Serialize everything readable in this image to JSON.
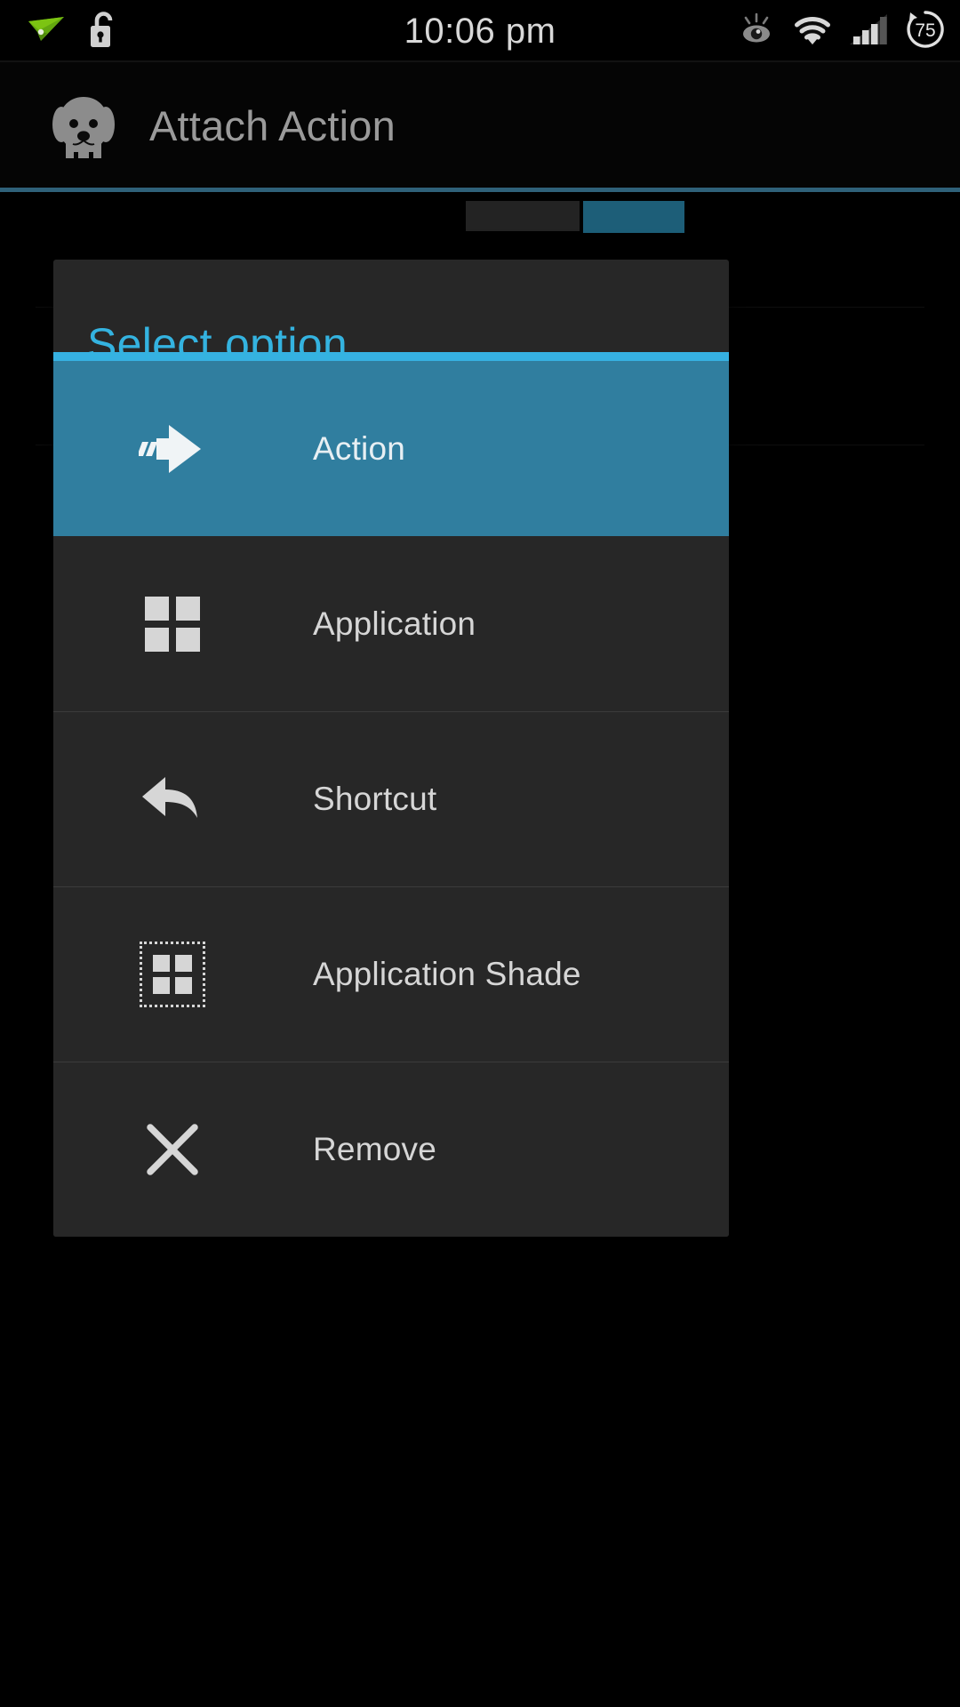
{
  "status_bar": {
    "time": "10:06 pm",
    "left_icons": [
      {
        "name": "airdroid-paperplane-icon",
        "label": "AirDroid"
      },
      {
        "name": "unlocked-padlock-icon",
        "label": "Unlocked"
      }
    ],
    "right_icons": [
      {
        "name": "eye-icon",
        "label": "Eye / screen filter"
      },
      {
        "name": "wifi-icon",
        "label": "Wi-Fi full signal"
      },
      {
        "name": "cellular-signal-icon",
        "label": "Cellular signal 3 of 4 bars"
      }
    ],
    "battery": {
      "name": "battery-circle-icon",
      "percent": "75"
    }
  },
  "action_bar": {
    "icon_name": "dog-app-icon",
    "title": "Attach Action"
  },
  "dialog": {
    "title": "Select option",
    "options": [
      {
        "label": "Action",
        "icon": "fast-forward-arrow-icon",
        "selected": true
      },
      {
        "label": "Application",
        "icon": "app-grid-icon",
        "selected": false
      },
      {
        "label": "Shortcut",
        "icon": "back-arrow-icon",
        "selected": false
      },
      {
        "label": "Application Shade",
        "icon": "app-shade-grid-icon",
        "selected": false
      },
      {
        "label": "Remove",
        "icon": "close-x-icon",
        "selected": false
      }
    ]
  },
  "colors": {
    "accent_blue": "#36b1e2",
    "selected_row": "#307e9f",
    "dialog_bg": "#272727",
    "screen_bg": "#000000",
    "title_text": "#34b3e0",
    "divider_teal": "#2f6179",
    "label_text": "#d6d6d6"
  }
}
